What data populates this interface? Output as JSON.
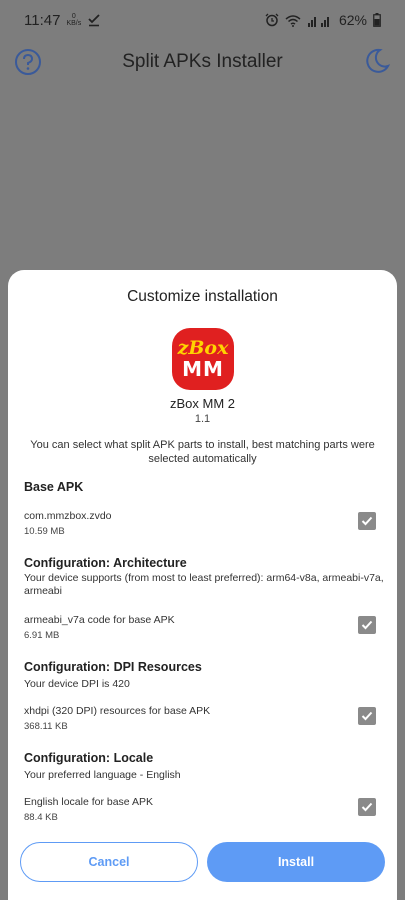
{
  "status_bar": {
    "time": "11:47",
    "net_speed_value": "0",
    "net_speed_unit": "KB/s",
    "battery": "62%"
  },
  "app_bar": {
    "title": "Split APKs Installer"
  },
  "sheet": {
    "title": "Customize installation",
    "app_icon_line1": "zBox",
    "app_icon_line2": "MM",
    "app_name": "zBox MM 2",
    "app_version": "1.1",
    "description": "You can select what split APK parts to install, best matching parts were selected automatically",
    "sections": [
      {
        "header": "Base APK",
        "subtitle": "",
        "parts": [
          {
            "name": "com.mmzbox.zvdo",
            "size": "10.59 MB",
            "checked": true
          }
        ]
      },
      {
        "header": "Configuration: Architecture",
        "subtitle": "Your device supports (from most to least preferred): arm64-v8a, armeabi-v7a, armeabi",
        "parts": [
          {
            "name": "armeabi_v7a code for base APK",
            "size": "6.91 MB",
            "checked": true
          }
        ]
      },
      {
        "header": "Configuration: DPI Resources",
        "subtitle": "Your device DPI is 420",
        "parts": [
          {
            "name": "xhdpi (320 DPI) resources for base APK",
            "size": "368.11 KB",
            "checked": true
          }
        ]
      },
      {
        "header": "Configuration: Locale",
        "subtitle": "Your preferred language - English",
        "parts": [
          {
            "name": "English locale for base APK",
            "size": "88.4 KB",
            "checked": true
          }
        ]
      }
    ],
    "cancel_label": "Cancel",
    "install_label": "Install"
  },
  "colors": {
    "accent": "#5e9bf5",
    "scrim": "#7d7d7d",
    "app_icon_bg": "#e02020",
    "checkbox": "#8a8a8a"
  },
  "icons": {
    "help": "help-circle-icon",
    "theme": "moon-icon",
    "alarm": "alarm-icon",
    "wifi": "wifi-icon",
    "signal": "signal-icon",
    "battery": "battery-icon",
    "download_done": "check-download-icon"
  }
}
